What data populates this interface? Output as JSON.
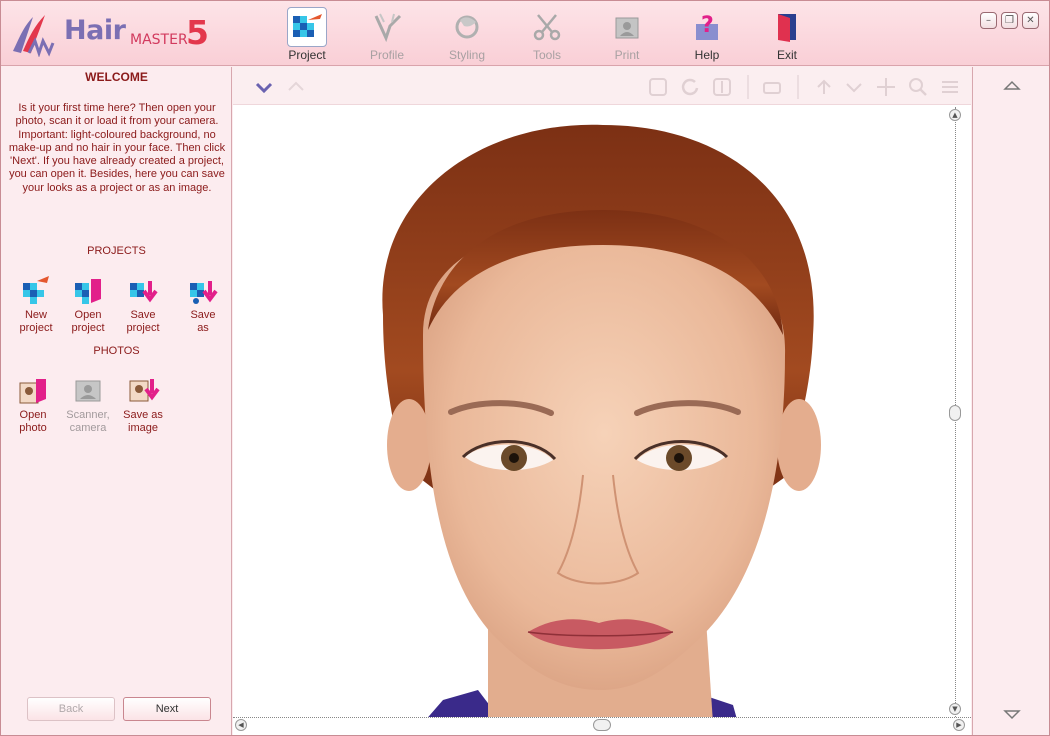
{
  "app": {
    "logo_hair": "Hair",
    "logo_master": "MASTER",
    "logo_version": "5"
  },
  "nav": [
    {
      "label": "Project",
      "icon": "project-icon",
      "state": "active"
    },
    {
      "label": "Profile",
      "icon": "profile-icon",
      "state": "disabled"
    },
    {
      "label": "Styling",
      "icon": "styling-icon",
      "state": "disabled"
    },
    {
      "label": "Tools",
      "icon": "tools-icon",
      "state": "disabled"
    },
    {
      "label": "Print",
      "icon": "print-icon",
      "state": "disabled"
    },
    {
      "label": "Help",
      "icon": "help-icon",
      "state": "enabled"
    },
    {
      "label": "Exit",
      "icon": "exit-icon",
      "state": "enabled"
    }
  ],
  "window_buttons": {
    "minimize": "–",
    "restore": "❐",
    "close": "✕"
  },
  "left": {
    "title": "WELCOME",
    "text": "Is it your first time here? Then open your photo, scan it or load it from your camera. Important: light-coloured background, no make-up and no hair in your face. Then click 'Next'. If you have already created a project, you can open it. Besides, here you can save your looks as a project or as an image.",
    "projects_title": "PROJECTS",
    "projects": [
      {
        "label1": "New",
        "label2": "project"
      },
      {
        "label1": "Open",
        "label2": "project"
      },
      {
        "label1": "Save",
        "label2": "project"
      },
      {
        "label1": "Save",
        "label2": "as"
      }
    ],
    "photos_title": "PHOTOS",
    "photos": [
      {
        "label1": "Open",
        "label2": "photo"
      },
      {
        "label1": "Scanner,",
        "label2": "camera"
      },
      {
        "label1": "Save as",
        "label2": "image"
      }
    ],
    "back_label": "Back",
    "next_label": "Next"
  },
  "colors": {
    "accent": "#8b1a1a",
    "panel_bg": "#fcecef",
    "logo_purple": "#7b6fb3",
    "logo_red": "#e3374c"
  }
}
